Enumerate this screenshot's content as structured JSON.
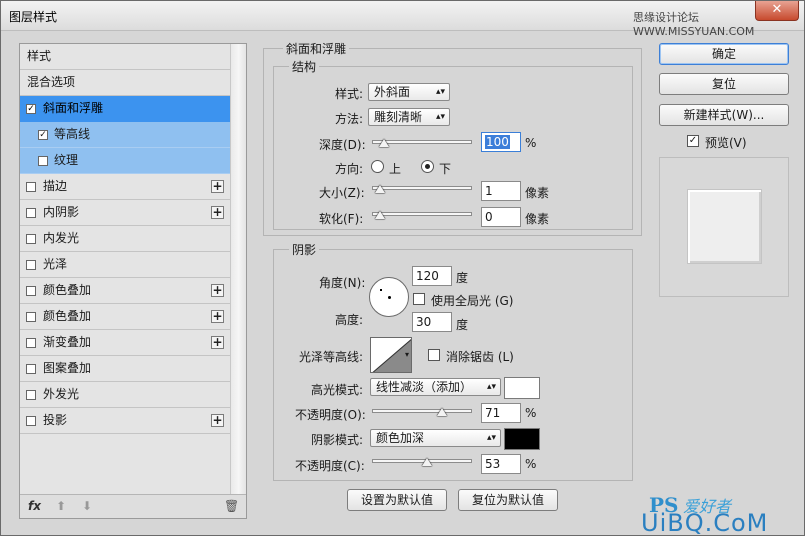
{
  "window": {
    "title": "图层样式",
    "watermark": "思缘设计论坛 WWW.MISSYUAN.COM"
  },
  "styles": [
    {
      "label": "样式",
      "checkbox": false,
      "plus": false,
      "state": "normal",
      "sub": false
    },
    {
      "label": "混合选项",
      "checkbox": false,
      "plus": false,
      "state": "normal",
      "sub": false
    },
    {
      "label": "斜面和浮雕",
      "checkbox": true,
      "checked": true,
      "plus": false,
      "state": "selected",
      "sub": false
    },
    {
      "label": "等高线",
      "checkbox": true,
      "checked": true,
      "plus": false,
      "state": "subsel",
      "sub": true
    },
    {
      "label": "纹理",
      "checkbox": true,
      "checked": false,
      "plus": false,
      "state": "subsel",
      "sub": true
    },
    {
      "label": "描边",
      "checkbox": true,
      "checked": false,
      "plus": true,
      "state": "normal",
      "sub": false
    },
    {
      "label": "内阴影",
      "checkbox": true,
      "checked": false,
      "plus": true,
      "state": "normal",
      "sub": false
    },
    {
      "label": "内发光",
      "checkbox": true,
      "checked": false,
      "plus": false,
      "state": "normal",
      "sub": false
    },
    {
      "label": "光泽",
      "checkbox": true,
      "checked": false,
      "plus": false,
      "state": "normal",
      "sub": false
    },
    {
      "label": "颜色叠加",
      "checkbox": true,
      "checked": false,
      "plus": true,
      "state": "normal",
      "sub": false
    },
    {
      "label": "颜色叠加",
      "checkbox": true,
      "checked": false,
      "plus": true,
      "state": "normal",
      "sub": false
    },
    {
      "label": "渐变叠加",
      "checkbox": true,
      "checked": false,
      "plus": true,
      "state": "normal",
      "sub": false
    },
    {
      "label": "图案叠加",
      "checkbox": true,
      "checked": false,
      "plus": false,
      "state": "normal",
      "sub": false
    },
    {
      "label": "外发光",
      "checkbox": true,
      "checked": false,
      "plus": false,
      "state": "normal",
      "sub": false
    },
    {
      "label": "投影",
      "checkbox": true,
      "checked": false,
      "plus": true,
      "state": "normal",
      "sub": false
    }
  ],
  "footer": {
    "fx": "fx",
    "up": "⬆",
    "down": "⬇",
    "trash": "🗑"
  },
  "bevel": {
    "section": "斜面和浮雕",
    "structure": "结构",
    "style_label": "样式:",
    "style_value": "外斜面",
    "technique_label": "方法:",
    "technique_value": "雕刻清晰",
    "depth_label": "深度(D):",
    "depth_value": "100",
    "depth_unit": "%",
    "depth_pos": 0.05,
    "direction_label": "方向:",
    "dir_up": "上",
    "dir_down": "下",
    "size_label": "大小(Z):",
    "size_value": "1",
    "size_unit": "像素",
    "size_pos": 0.0,
    "soften_label": "软化(F):",
    "soften_value": "0",
    "soften_unit": "像素",
    "soften_pos": 0.0
  },
  "shading": {
    "section": "阴影",
    "angle_label": "角度(N):",
    "angle_value": "120",
    "angle_unit": "度",
    "global_light": "使用全局光 (G)",
    "altitude_label": "高度:",
    "altitude_value": "30",
    "altitude_unit": "度",
    "gloss_label": "光泽等高线:",
    "antialias": "消除锯齿 (L)",
    "highlight_label": "高光模式:",
    "highlight_value": "线性减淡（添加）",
    "highlight_color": "#ffffff",
    "hl_opacity_label": "不透明度(O):",
    "hl_opacity_value": "71",
    "hl_opacity_unit": "%",
    "hl_opacity_pos": 0.71,
    "shadow_label": "阴影模式:",
    "shadow_value": "颜色加深",
    "shadow_color": "#000000",
    "sh_opacity_label": "不透明度(C):",
    "sh_opacity_value": "53",
    "sh_opacity_unit": "%",
    "sh_opacity_pos": 0.53
  },
  "buttons": {
    "make_default": "设置为默认值",
    "reset_default": "复位为默认值",
    "ok": "确定",
    "reset": "复位",
    "new_style": "新建样式(W)...",
    "preview": "预览(V)"
  },
  "brand": {
    "ps": "PS",
    "cn": "爱好者",
    "url": "UiBQ.CoM"
  }
}
